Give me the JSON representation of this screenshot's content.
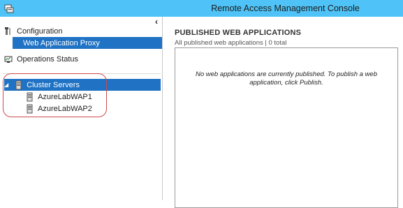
{
  "window": {
    "title": "Remote Access Management Console"
  },
  "nav": {
    "collapse_glyph": "‹",
    "configuration": {
      "label": "Configuration",
      "icon": "wrench-icon"
    },
    "web_application_proxy": {
      "label": "Web Application Proxy"
    },
    "operations_status": {
      "label": "Operations Status",
      "icon": "monitor-status-icon"
    },
    "cluster": {
      "label": "Cluster Servers",
      "expand_glyph": "◢",
      "servers": [
        {
          "label": "AzureLabWAP1",
          "icon": "server-icon"
        },
        {
          "label": "AzureLabWAP2",
          "icon": "server-icon"
        }
      ]
    }
  },
  "main": {
    "title": "PUBLISHED WEB APPLICATIONS",
    "subtitle": "All published web applications | 0 total",
    "empty_message": "No web applications are currently published. To publish a web application, click Publish."
  },
  "colors": {
    "titlebar": "#4fc3f7",
    "selection": "#1f72c4",
    "annotation": "#cf4a4a"
  }
}
